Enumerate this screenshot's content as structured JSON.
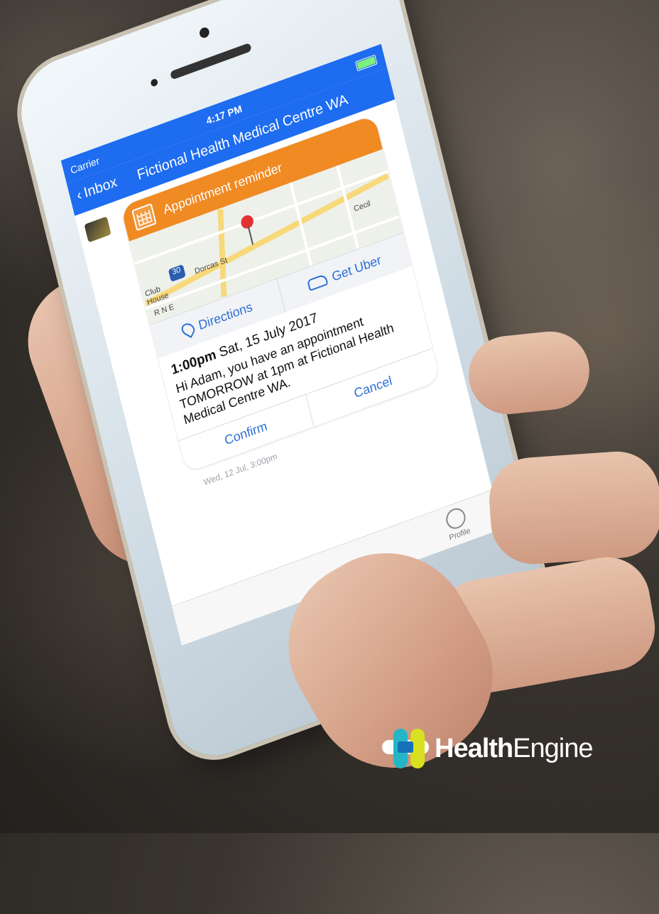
{
  "status_bar": {
    "carrier": "Carrier",
    "time": "4:17 PM"
  },
  "nav": {
    "back_label": "Inbox",
    "title": "Fictional Health Medical Centre WA"
  },
  "message": {
    "header": "Appointment reminder",
    "map_labels": {
      "shield": "30",
      "street1": "Dorcas St",
      "street2": "Cecil",
      "place": "Club House",
      "area": "RNE"
    },
    "directions_label": "Directions",
    "uber_label": "Get Uber",
    "time_bold": "1:00pm",
    "date": "Sat, 15 July 2017",
    "body": "Hi Adam, you have an appointment TOMORROW at 1pm at Fictional Health Medical Centre WA.",
    "confirm_label": "Confirm",
    "cancel_label": "Cancel",
    "timestamp": "Wed, 12 Jul, 3:00pm"
  },
  "tabbar": {
    "profile_label": "Profile"
  },
  "brand": {
    "strong": "Health",
    "rest": "Engine"
  },
  "colors": {
    "nav_blue": "#1e6cf0",
    "header_orange": "#f08a22",
    "link_blue": "#2b6fd6"
  }
}
